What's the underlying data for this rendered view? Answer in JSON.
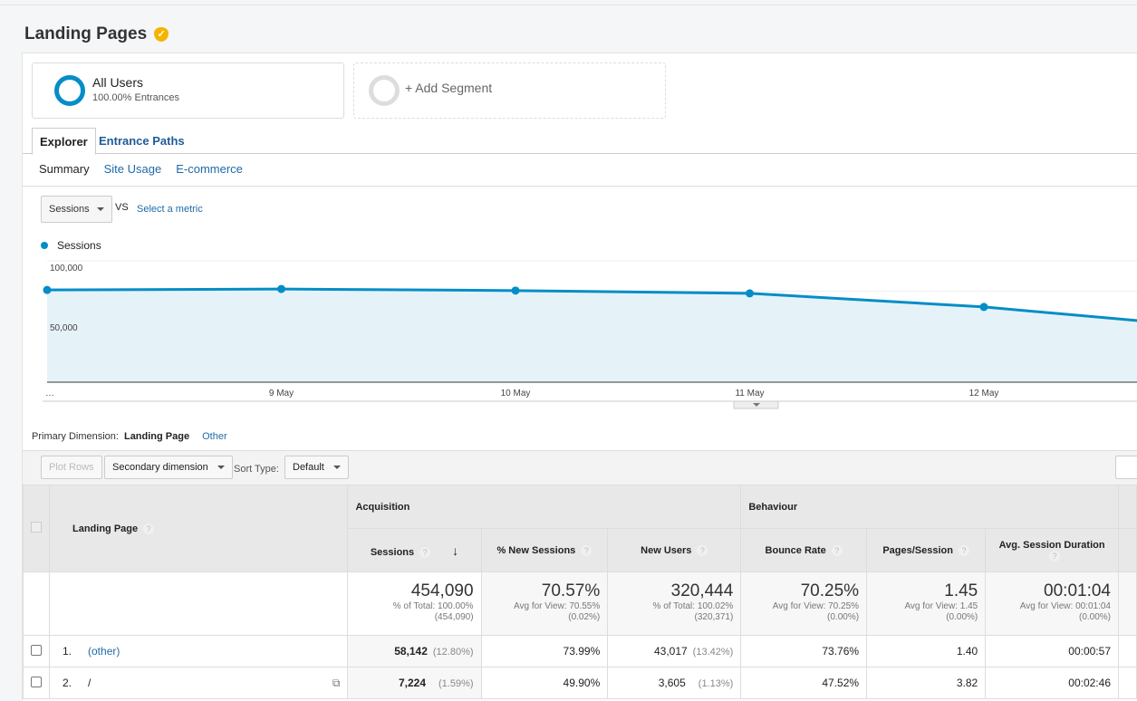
{
  "page": {
    "title": "Landing Pages"
  },
  "segments": [
    {
      "name": "All Users",
      "detail": "100.00% Entrances"
    },
    {
      "name": "+ Add Segment"
    }
  ],
  "tabs": [
    "Explorer",
    "Entrance Paths"
  ],
  "subtabs": [
    "Summary",
    "Site Usage",
    "E-commerce"
  ],
  "metric_select": {
    "value": "Sessions",
    "vs": "VS",
    "select_metric": "Select a metric"
  },
  "chart_data": {
    "type": "area",
    "series": [
      {
        "name": "Sessions",
        "values": [
          76000,
          76800,
          75500,
          73200,
          62000,
          50700
        ]
      }
    ],
    "categories": [
      "…",
      "9 May",
      "10 May",
      "11 May",
      "12 May",
      ""
    ],
    "yticks": [
      "100,000",
      "50,000"
    ],
    "ylim": [
      0,
      100000
    ],
    "color": "#058dc7",
    "fill": "#e5f3f9",
    "grid": true,
    "legend": "top-left"
  },
  "dimension": {
    "label": "Primary Dimension:",
    "value": "Landing Page",
    "other": "Other"
  },
  "toolbar": {
    "plot_rows": "Plot Rows",
    "secondary": "Secondary dimension",
    "sort_label": "Sort Type:",
    "sort_value": "Default"
  },
  "table": {
    "groups": [
      "Acquisition",
      "Behaviour"
    ],
    "dim_header": "Landing Page",
    "columns": [
      "Sessions",
      "% New Sessions",
      "New Users",
      "Bounce Rate",
      "Pages/Session",
      "Avg. Session Duration"
    ],
    "totals": [
      {
        "value": "454,090",
        "l1": "% of Total: 100.00%",
        "l2": "(454,090)"
      },
      {
        "value": "70.57%",
        "l1": "Avg for View: 70.55%",
        "l2": "(0.02%)"
      },
      {
        "value": "320,444",
        "l1": "% of Total: 100.02%",
        "l2": "(320,371)"
      },
      {
        "value": "70.25%",
        "l1": "Avg for View: 70.25%",
        "l2": "(0.00%)"
      },
      {
        "value": "1.45",
        "l1": "Avg for View: 1.45",
        "l2": "(0.00%)"
      },
      {
        "value": "00:01:04",
        "l1": "Avg for View: 00:01:04",
        "l2": "(0.00%)"
      }
    ],
    "rows": [
      {
        "n": "1.",
        "page": "(other)",
        "sessions": "58,142",
        "sessions_pct": "(12.80%)",
        "new_sessions": "73.99%",
        "new_users": "43,017",
        "new_users_pct": "(13.42%)",
        "bounce": "73.76%",
        "pps": "1.40",
        "dur": "00:00:57"
      },
      {
        "n": "2.",
        "page": "/",
        "sessions": "7,224",
        "sessions_pct": "(1.59%)",
        "new_sessions": "49.90%",
        "new_users": "3,605",
        "new_users_pct": "(1.13%)",
        "bounce": "47.52%",
        "pps": "3.82",
        "dur": "00:02:46"
      }
    ]
  }
}
